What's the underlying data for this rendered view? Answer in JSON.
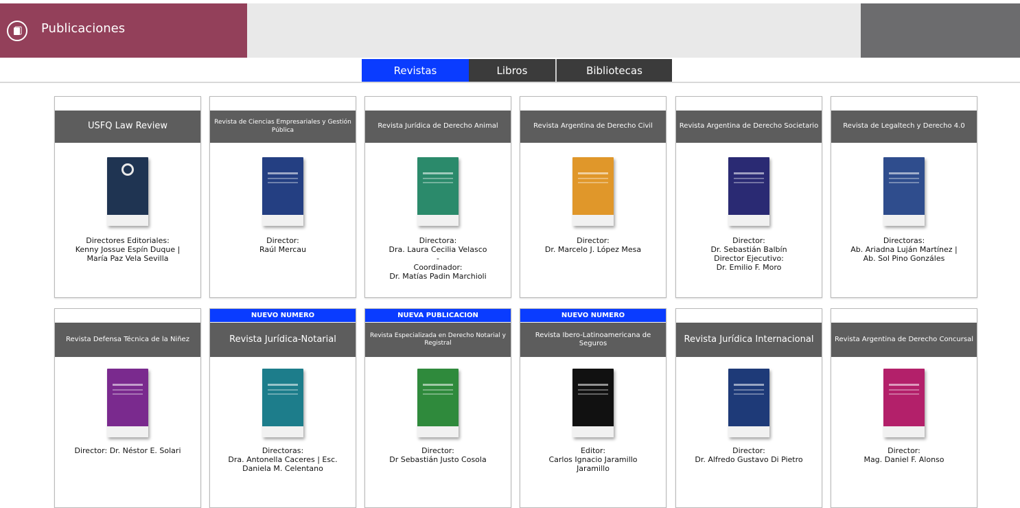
{
  "header": {
    "title": "Publicaciones",
    "icon": "publications-icon"
  },
  "tabs": [
    {
      "label": "Revistas",
      "active": true
    },
    {
      "label": "Libros",
      "active": false
    },
    {
      "label": "Bibliotecas",
      "active": false
    }
  ],
  "cards": [
    {
      "title": "USFQ Law Review",
      "badge": "",
      "cover_color": "#1f3452",
      "lines": [
        "Directores Editoriales:",
        "Kenny Jossue Espín Duque |",
        "María Paz Vela Sevilla"
      ]
    },
    {
      "title": "Revista de Ciencias Empresariales y Gestión Pública",
      "badge": "",
      "cover_color": "#243f82",
      "lines": [
        "Director:",
        "Raúl Mercau"
      ]
    },
    {
      "title": "Revista Jurídica de Derecho Animal",
      "badge": "",
      "cover_color": "#2b8a6b",
      "lines": [
        "Directora:",
        "Dra. Laura Cecilia Velasco",
        "-",
        "Coordinador:",
        "Dr. Matías Padin Marchioli"
      ]
    },
    {
      "title": "Revista Argentina de Derecho Civil",
      "badge": "",
      "cover_color": "#e0972a",
      "lines": [
        "Director:",
        "Dr. Marcelo J. López Mesa"
      ]
    },
    {
      "title": "Revista Argentina de Derecho Societario",
      "badge": "",
      "cover_color": "#2a2a73",
      "lines": [
        "Director:",
        "Dr. Sebastián Balbín",
        "Director Ejecutivo:",
        "Dr. Emilio F. Moro"
      ]
    },
    {
      "title": "Revista de Legaltech y Derecho 4.0",
      "badge": "",
      "cover_color": "#2f4d8d",
      "lines": [
        "Directoras:",
        "Ab. Ariadna Luján Martínez |",
        "Ab. Sol Pino Gonzáles"
      ]
    },
    {
      "title": "Revista Defensa Técnica de la Niñez",
      "badge": "",
      "cover_color": "#7a2a8e",
      "lines": [
        "Director: Dr. Néstor E. Solari"
      ]
    },
    {
      "title": "Revista Jurídica-Notarial",
      "badge": "NUEVO NUMERO",
      "cover_color": "#1d7d8b",
      "lines": [
        "Directoras:",
        "Dra. Antonella Caceres | Esc.",
        "Daniela M. Celentano"
      ]
    },
    {
      "title": "Revista Especializada en Derecho Notarial y Registral",
      "badge": "NUEVA PUBLICACION",
      "cover_color": "#2f8a3c",
      "lines": [
        "Director:",
        "Dr Sebastián Justo Cosola"
      ]
    },
    {
      "title": "Revista Ibero-Latinoamericana de Seguros",
      "badge": "NUEVO NUMERO",
      "cover_color": "#111111",
      "lines": [
        "Editor:",
        "Carlos Ignacio Jaramillo",
        "Jaramillo"
      ]
    },
    {
      "title": "Revista Jurídica Internacional",
      "badge": "",
      "cover_color": "#1e3a78",
      "lines": [
        "Director:",
        "Dr. Alfredo Gustavo Di Pietro"
      ]
    },
    {
      "title": "Revista Argentina de Derecho Concursal",
      "badge": "",
      "cover_color": "#b3206a",
      "lines": [
        "Director:",
        "Mag. Daniel F. Alonso"
      ]
    }
  ]
}
